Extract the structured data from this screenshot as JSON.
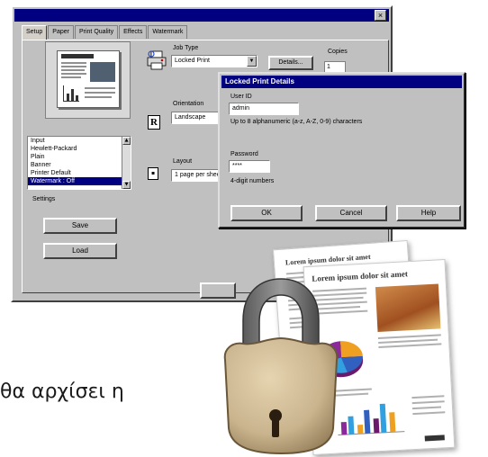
{
  "print_window": {
    "tabs": [
      "Setup",
      "Paper",
      "Print Quality",
      "Effects",
      "Watermark"
    ],
    "close_glyph": "×",
    "job_type_label": "Job Type",
    "job_type_value": "Locked Print",
    "details_button": "Details...",
    "copies_label": "Copies",
    "copies_value": "1",
    "orientation_label": "Orientation",
    "orientation_value": "Landscape",
    "orientation_icon": "R",
    "layout_label": "Layout",
    "layout_value": "1 page per sheet",
    "presets": [
      "Input",
      "Hewlett-Packard",
      "Plain",
      "Banner",
      "Printer Default",
      "Watermark : Off"
    ],
    "settings_label": "Settings",
    "save_button": "Save",
    "load_button": "Load"
  },
  "locked_dialog": {
    "title": "Locked Print Details",
    "user_id_label": "User ID",
    "user_id_value": "admin",
    "user_id_hint": "Up to 8 alphanumeric (a-z, A-Z, 0-9) characters",
    "password_label": "Password",
    "password_value": "****",
    "password_hint": "4-digit numbers",
    "ok_button": "OK",
    "cancel_button": "Cancel",
    "help_button": "Help"
  },
  "caption": {
    "text": "θα αρχίσει η"
  },
  "documents": {
    "back_title": "Lorem ipsum dolor sit amet",
    "front_title": "Lorem ipsum dolor sit amet"
  },
  "colors": {
    "title_bar": "#000080",
    "window_face": "#c0c0c0",
    "lock_body": "#c9b48e",
    "lock_shackle": "#6e6e6e"
  },
  "icons": [
    "printer-icon",
    "padlock-icon",
    "orientation-icon",
    "layout-icon",
    "close-icon"
  ]
}
